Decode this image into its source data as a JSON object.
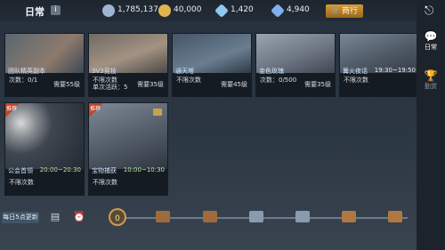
{
  "header": {
    "title": "日常",
    "info_icon": "i",
    "currencies": [
      {
        "icon": "bound-gem-icon",
        "value": "1,785,137",
        "color": "#9fb6d2"
      },
      {
        "icon": "gold-coin-icon",
        "value": "40,000",
        "color": "#e1b44f"
      },
      {
        "icon": "diamond-icon",
        "value": "1,420",
        "color": "#8cc8ef"
      },
      {
        "icon": "bound-diamond-icon",
        "value": "4,940",
        "color": "#7fb2ea"
      }
    ],
    "shop_label": "商行",
    "shop_cart": "🛒"
  },
  "cards": [
    {
      "name": "团队精英副本",
      "time": "",
      "line1": "次数：0/1",
      "line2": "",
      "req": "需要55级",
      "tag": "",
      "art": "#5a6672",
      "art2": "#8d7b6d"
    },
    {
      "name": "3V3竞技",
      "time": "",
      "line1": "不限次数",
      "line2": "单次活跃：5",
      "req": "需要35级",
      "tag": "",
      "art": "#6f6a65",
      "art2": "#a39282"
    },
    {
      "name": "通天塔",
      "time": "",
      "line1": "不限次数",
      "line2": "",
      "req": "需要45级",
      "tag": "",
      "art": "#445566",
      "art2": "#6a7e90"
    },
    {
      "name": "金色玫瑰",
      "time": "",
      "line1": "次数：0/500",
      "line2": "",
      "req": "需要35级",
      "tag": "",
      "art": "#6d7682",
      "art2": "#9aa5b2"
    },
    {
      "name": "篝火夜话",
      "time": "19:30~19:50",
      "line1": "不限次数",
      "line2": "",
      "req": "",
      "tag": "",
      "art": "#4f5a66",
      "art2": "#7a8796"
    },
    {
      "name": "公会首领",
      "time": "20:00~20:30",
      "line1": "不限次数",
      "line2": "",
      "req": "",
      "tag": "推荐",
      "art": "#3e4650",
      "art2": "#606a76"
    },
    {
      "name": "宝物捕获",
      "time": "10:00~10:30",
      "line1": "不限次数",
      "line2": "",
      "req": "",
      "tag": "推荐",
      "art": "#555f6b",
      "art2": "#7f8a97"
    }
  ],
  "right_panel": {
    "exit_icon": "exit-icon",
    "tabs": [
      {
        "label": "日常",
        "icon": "💬",
        "active": true
      },
      {
        "label": "勤赏",
        "icon": "🏆",
        "active": false
      }
    ]
  },
  "bottom": {
    "reset_label": "每日5点更新",
    "progress_value": "0",
    "chests": [
      "#a06b3a",
      "#a06b3a",
      "#8a9bb0",
      "#8a9bb0",
      "#b07840",
      "#b07840"
    ]
  }
}
